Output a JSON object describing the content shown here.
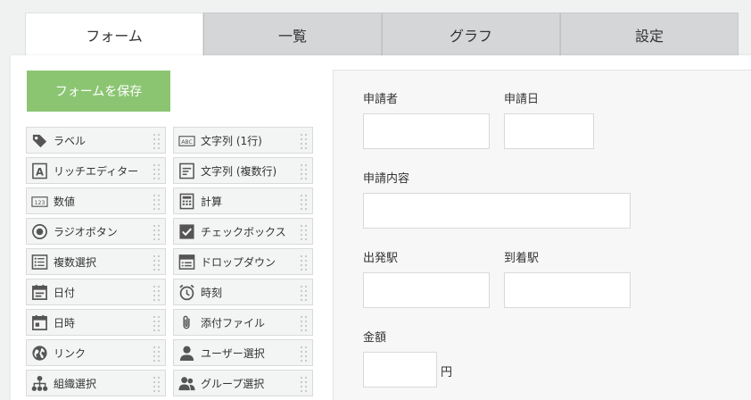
{
  "tabs": [
    {
      "label": "フォーム",
      "active": true
    },
    {
      "label": "一覧",
      "active": false
    },
    {
      "label": "グラフ",
      "active": false
    },
    {
      "label": "設定",
      "active": false
    }
  ],
  "save_button": {
    "label": "フォームを保存",
    "color": "#8bc572"
  },
  "palette": [
    {
      "label": "ラベル",
      "icon": "tag-icon"
    },
    {
      "label": "文字列 (1行)",
      "icon": "abc-icon"
    },
    {
      "label": "リッチエディター",
      "icon": "rich-text-icon"
    },
    {
      "label": "文字列 (複数行)",
      "icon": "multiline-text-icon"
    },
    {
      "label": "数値",
      "icon": "number-icon"
    },
    {
      "label": "計算",
      "icon": "calculator-icon"
    },
    {
      "label": "ラジオボタン",
      "icon": "radio-icon"
    },
    {
      "label": "チェックボックス",
      "icon": "checkbox-icon"
    },
    {
      "label": "複数選択",
      "icon": "multi-select-icon"
    },
    {
      "label": "ドロップダウン",
      "icon": "dropdown-icon"
    },
    {
      "label": "日付",
      "icon": "date-icon"
    },
    {
      "label": "時刻",
      "icon": "clock-icon"
    },
    {
      "label": "日時",
      "icon": "datetime-icon"
    },
    {
      "label": "添付ファイル",
      "icon": "attachment-icon"
    },
    {
      "label": "リンク",
      "icon": "globe-icon"
    },
    {
      "label": "ユーザー選択",
      "icon": "user-icon"
    },
    {
      "label": "組織選択",
      "icon": "org-icon"
    },
    {
      "label": "グループ選択",
      "icon": "group-icon"
    }
  ],
  "form": {
    "applicant_label": "申請者",
    "apply_date_label": "申請日",
    "content_label": "申請内容",
    "departure_label": "出発駅",
    "arrival_label": "到着駅",
    "amount_label": "金額",
    "amount_unit": "円"
  }
}
